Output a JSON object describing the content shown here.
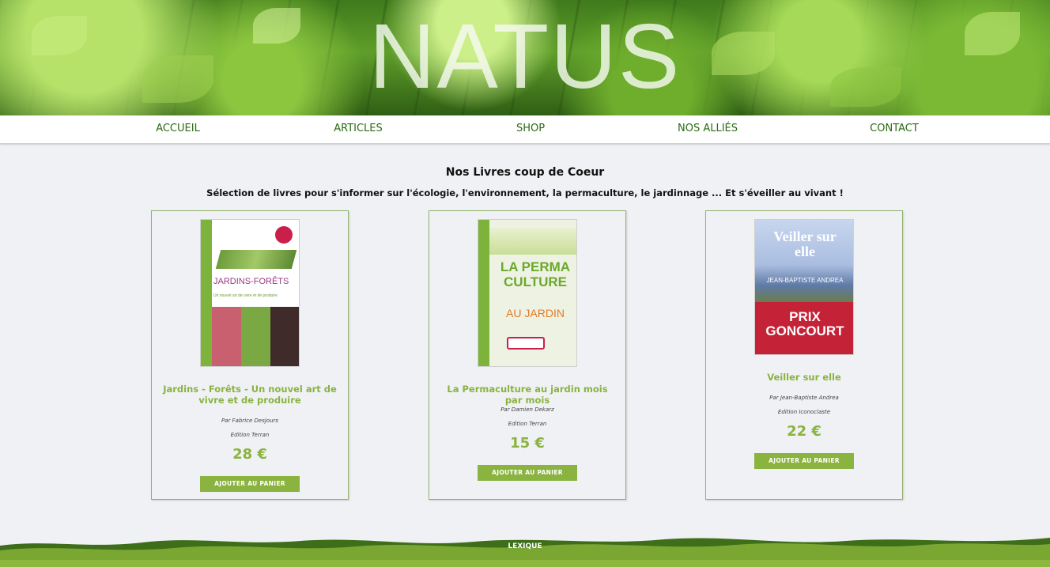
{
  "header": {
    "logo_text": "NATUS"
  },
  "nav": {
    "items": [
      {
        "label": "ACCUEIL"
      },
      {
        "label": "ARTICLES"
      },
      {
        "label": "SHOP"
      },
      {
        "label": "NOS ALLIÉS"
      },
      {
        "label": "CONTACT"
      }
    ]
  },
  "main": {
    "title": "Nos Livres coup de Coeur",
    "subtitle": "Sélection de livres pour s'informer sur l'écologie, l'environnement, la permaculture, le jardinnage ... Et s'éveiller au vivant !",
    "products": [
      {
        "title": "Jardins - Forêts - Un nouvel art de vivre et de produire",
        "author": "Par Fabrice Desjours",
        "edition": "Edition Terran",
        "price": "28 €",
        "button_label": "AJOUTER AU PANIER",
        "cover_text": {
          "title": "JARDINS-FORÊTS",
          "subtitle": "Un nouvel art de vivre et de produire"
        }
      },
      {
        "title": "La Permaculture au jardin mois par mois",
        "author": "Par Damien Dekarz",
        "edition": "Edition Terran",
        "price": "15 €",
        "button_label": "AJOUTER AU PANIER",
        "cover_text": {
          "title": "LA PERMA CULTURE",
          "subtitle": "AU JARDIN"
        }
      },
      {
        "title": "Veiller sur elle",
        "author": "Par Jean-Baptiste Andrea",
        "edition": "Edition Iconoclaste",
        "price": "22 €",
        "button_label": "AJOUTER AU PANIER",
        "cover_text": {
          "title": "Veiller sur elle",
          "author": "JEAN-BAPTISTE ANDREA",
          "prize": "PRIX GONCOURT"
        }
      }
    ]
  },
  "footer": {
    "link_label": "LEXIQUE"
  },
  "colors": {
    "accent": "#8ab33f",
    "nav_text": "#2b6a12",
    "background": "#f0f1f5",
    "footer_green": "#6f9a2c"
  }
}
